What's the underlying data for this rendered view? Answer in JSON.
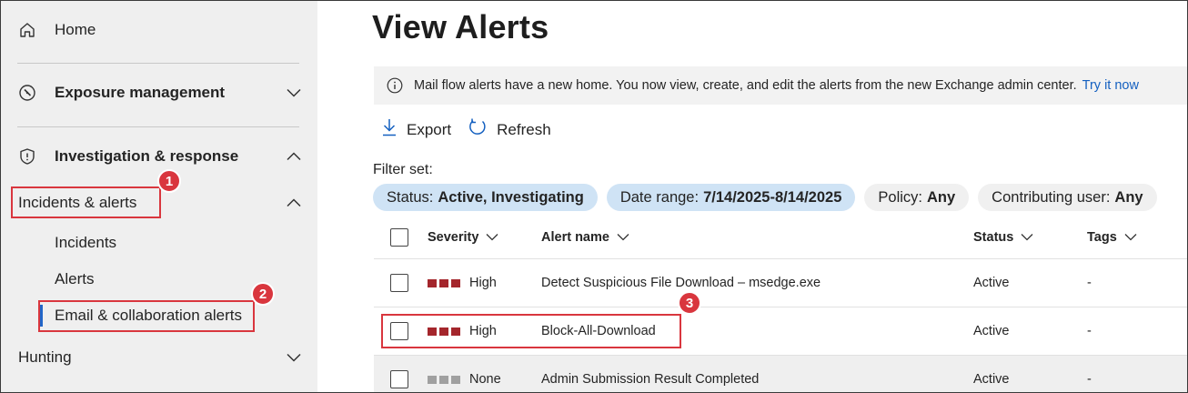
{
  "sidebar": {
    "home_label": "Home",
    "exposure_label": "Exposure management",
    "investigation_label": "Investigation & response",
    "incidents_alerts_label": "Incidents & alerts",
    "sub_items": {
      "incidents": "Incidents",
      "alerts": "Alerts",
      "email_collab": "Email & collaboration alerts"
    },
    "hunting_label": "Hunting"
  },
  "annotations": {
    "badge_1": "1",
    "badge_2": "2",
    "badge_3": "3"
  },
  "page": {
    "title": "View Alerts"
  },
  "banner": {
    "text": "Mail flow alerts have a new home. You now view, create, and edit the alerts from the new Exchange admin center.",
    "link": "Try it now"
  },
  "toolbar": {
    "export_label": "Export",
    "refresh_label": "Refresh"
  },
  "filters": {
    "label": "Filter set:",
    "pills": [
      {
        "key": "Status:",
        "value": "Active, Investigating"
      },
      {
        "key": "Date range:",
        "value": "7/14/2025-8/14/2025"
      },
      {
        "key": "Policy:",
        "value": "Any"
      },
      {
        "key": "Contributing user:",
        "value": "Any"
      }
    ]
  },
  "table": {
    "headers": {
      "severity": "Severity",
      "alert_name": "Alert name",
      "status": "Status",
      "tags": "Tags"
    },
    "rows": [
      {
        "severity": "High",
        "name": "Detect Suspicious File Download – msedge.exe",
        "status": "Active",
        "tags": "-"
      },
      {
        "severity": "High",
        "name": "Block-All-Download",
        "status": "Active",
        "tags": "-"
      },
      {
        "severity": "None",
        "name": "Admin Submission Result Completed",
        "status": "Active",
        "tags": "-"
      }
    ]
  },
  "colors": {
    "severity_high": "#a4262c",
    "severity_none": "#a0a0a0",
    "annotation_red": "#d9363e",
    "link_blue": "#1460c0",
    "active_pill": "#cfe3f5"
  }
}
